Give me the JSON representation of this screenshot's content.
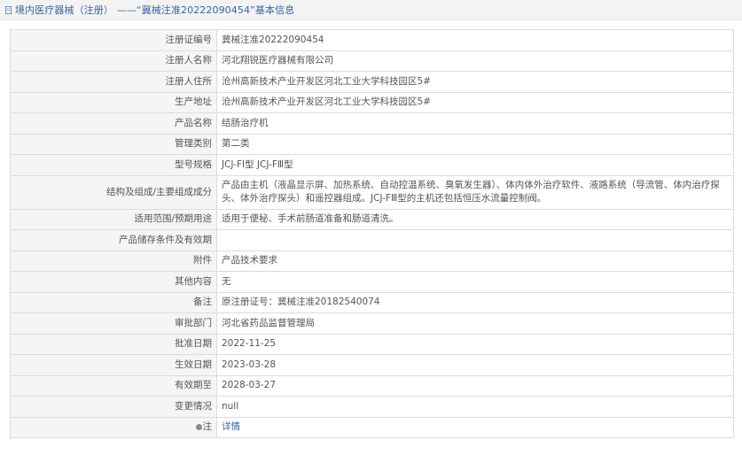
{
  "header": {
    "title": "境内医疗器械（注册） ——“冀械注准20222090454”基本信息",
    "icon": "page-icon"
  },
  "rows": [
    {
      "label": "注册证编号",
      "value": "冀械注准20222090454"
    },
    {
      "label": "注册人名称",
      "value": "河北翔锐医疗器械有限公司"
    },
    {
      "label": "注册人住所",
      "value": "沧州高新技术产业开发区河北工业大学科技园区5#"
    },
    {
      "label": "生产地址",
      "value": "沧州高新技术产业开发区河北工业大学科技园区5#"
    },
    {
      "label": "产品名称",
      "value": "结肠治疗机"
    },
    {
      "label": "管理类别",
      "value": "第二类"
    },
    {
      "label": "型号规格",
      "value": "JCJ-FⅠ型 JCJ-FⅢ型"
    },
    {
      "label": "结构及组成/主要组成成分",
      "value": "产品由主机（液晶显示屏、加热系统、自动控温系统、臭氧发生器）、体内体外治疗软件、液路系统（导流管、体内治疗探头、体外治疗探头）和遥控器组成。JCJ-FⅢ型的主机还包括恒压水流量控制阀。"
    },
    {
      "label": "适用范围/预期用途",
      "value": "适用于便秘、手术前肠道准备和肠道清洗。"
    },
    {
      "label": "产品储存条件及有效期",
      "value": ""
    },
    {
      "label": "附件",
      "value": "产品技术要求"
    },
    {
      "label": "其他内容",
      "value": "无"
    },
    {
      "label": "备注",
      "value": "原注册证号：冀械注准20182540074"
    },
    {
      "label": "审批部门",
      "value": "河北省药品监督管理局"
    },
    {
      "label": "批准日期",
      "value": "2022-11-25"
    },
    {
      "label": "生效日期",
      "value": "2023-03-28"
    },
    {
      "label": "有效期至",
      "value": "2028-03-27"
    },
    {
      "label": "变更情况",
      "value": "null"
    }
  ],
  "note": {
    "label": "注",
    "link_text": "详情",
    "icon": "note-icon"
  },
  "colors": {
    "link": "#3565a8",
    "label_bg": "#f5f5f5",
    "border": "#dcdcdc",
    "title_bg": "#f3f3f3"
  }
}
